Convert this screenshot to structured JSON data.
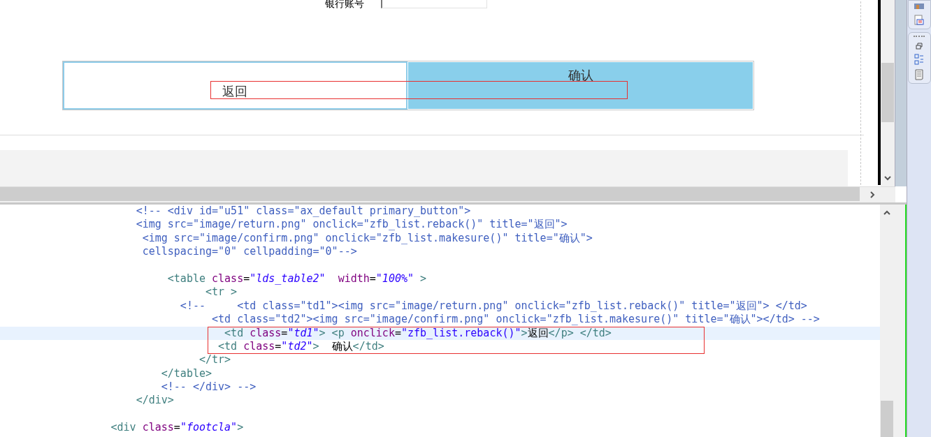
{
  "design_view": {
    "bank_account": {
      "label": "银行账号"
    },
    "buttons": [
      {
        "kind": "back",
        "label": "返回"
      },
      {
        "kind": "confirm",
        "label": "确认"
      }
    ]
  },
  "code_editor": {
    "lines": [
      {
        "current": false,
        "tokens": [
          {
            "kind": "comment",
            "t": "                     <!-- <div id=\"u51\" class=\"ax_default primary_button\">"
          }
        ]
      },
      {
        "current": false,
        "tokens": [
          {
            "kind": "comment",
            "t": "                     <img src=\"image/return.png\" onclick=\"zfb_list.reback()\" title=\"返回\">"
          }
        ]
      },
      {
        "current": false,
        "tokens": [
          {
            "kind": "comment",
            "t": "                      <img src=\"image/confirm.png\" onclick=\"zfb_list.makesure()\" title=\"确认\">"
          }
        ]
      },
      {
        "current": false,
        "tokens": [
          {
            "kind": "comment",
            "t": "                      cellspacing=\"0\" cellpadding=\"0\"-->"
          }
        ]
      },
      {
        "current": false
      },
      {
        "current": false,
        "tokens": [
          {
            "kind": "tag",
            "t": "                          <table "
          },
          {
            "kind": "attr",
            "t": "class"
          },
          {
            "kind": "text",
            "t": "="
          },
          {
            "kind": "val",
            "t": "\"lds_table2\"  "
          },
          {
            "kind": "attr",
            "t": "width"
          },
          {
            "kind": "text",
            "t": "="
          },
          {
            "kind": "val",
            "t": "\"100%\""
          },
          {
            "kind": "tag",
            "t": " >"
          }
        ]
      },
      {
        "current": false,
        "tokens": [
          {
            "kind": "tag",
            "t": "                                <tr >"
          }
        ]
      },
      {
        "current": false,
        "tokens": [
          {
            "kind": "comment",
            "t": "                            <!--     <td class=\"td1\"><img src=\"image/return.png\" onclick=\"zfb_list.reback()\" title=\"返回\"> </td>"
          }
        ]
      },
      {
        "current": false,
        "tokens": [
          {
            "kind": "comment",
            "t": "                                 <td class=\"td2\"><img src=\"image/confirm.png\" onclick=\"zfb_list.makesure()\" title=\"确认\"></td> -->"
          }
        ]
      },
      {
        "current": true,
        "tokens": [
          {
            "kind": "tag",
            "t": "                                   <td "
          },
          {
            "kind": "attr",
            "t": "class"
          },
          {
            "kind": "text",
            "t": "="
          },
          {
            "kind": "val",
            "t": "\"td1\""
          },
          {
            "kind": "tag",
            "t": "> <p "
          },
          {
            "kind": "attr",
            "t": "onclick"
          },
          {
            "kind": "text",
            "t": "="
          },
          {
            "kind": "str",
            "t": "\"zfb_list.reback()\""
          },
          {
            "kind": "tag",
            "t": ">"
          },
          {
            "kind": "text",
            "t": "返回"
          },
          {
            "kind": "tag",
            "t": "</p> </td>"
          }
        ]
      },
      {
        "current": false,
        "tokens": [
          {
            "kind": "tag",
            "t": "                                  <td "
          },
          {
            "kind": "attr",
            "t": "class"
          },
          {
            "kind": "text",
            "t": "="
          },
          {
            "kind": "val",
            "t": "\"td2\""
          },
          {
            "kind": "tag",
            "t": ">"
          },
          {
            "kind": "text",
            "t": "  确认"
          },
          {
            "kind": "tag",
            "t": "</td>"
          }
        ]
      },
      {
        "current": false,
        "tokens": [
          {
            "kind": "tag",
            "t": "                               </tr>"
          }
        ]
      },
      {
        "current": false,
        "tokens": [
          {
            "kind": "tag",
            "t": "                         </table>"
          }
        ]
      },
      {
        "current": false,
        "tokens": [
          {
            "kind": "comment",
            "t": "                         <!-- </div> -->"
          }
        ]
      },
      {
        "current": false,
        "tokens": [
          {
            "kind": "tag",
            "t": "                     </div>"
          }
        ]
      },
      {
        "current": false
      },
      {
        "current": false,
        "tokens": [
          {
            "kind": "tag",
            "t": "                 <div "
          },
          {
            "kind": "attr",
            "t": "class"
          },
          {
            "kind": "text",
            "t": "="
          },
          {
            "kind": "val",
            "t": "\"footcla\""
          },
          {
            "kind": "tag",
            "t": ">"
          }
        ]
      }
    ]
  }
}
